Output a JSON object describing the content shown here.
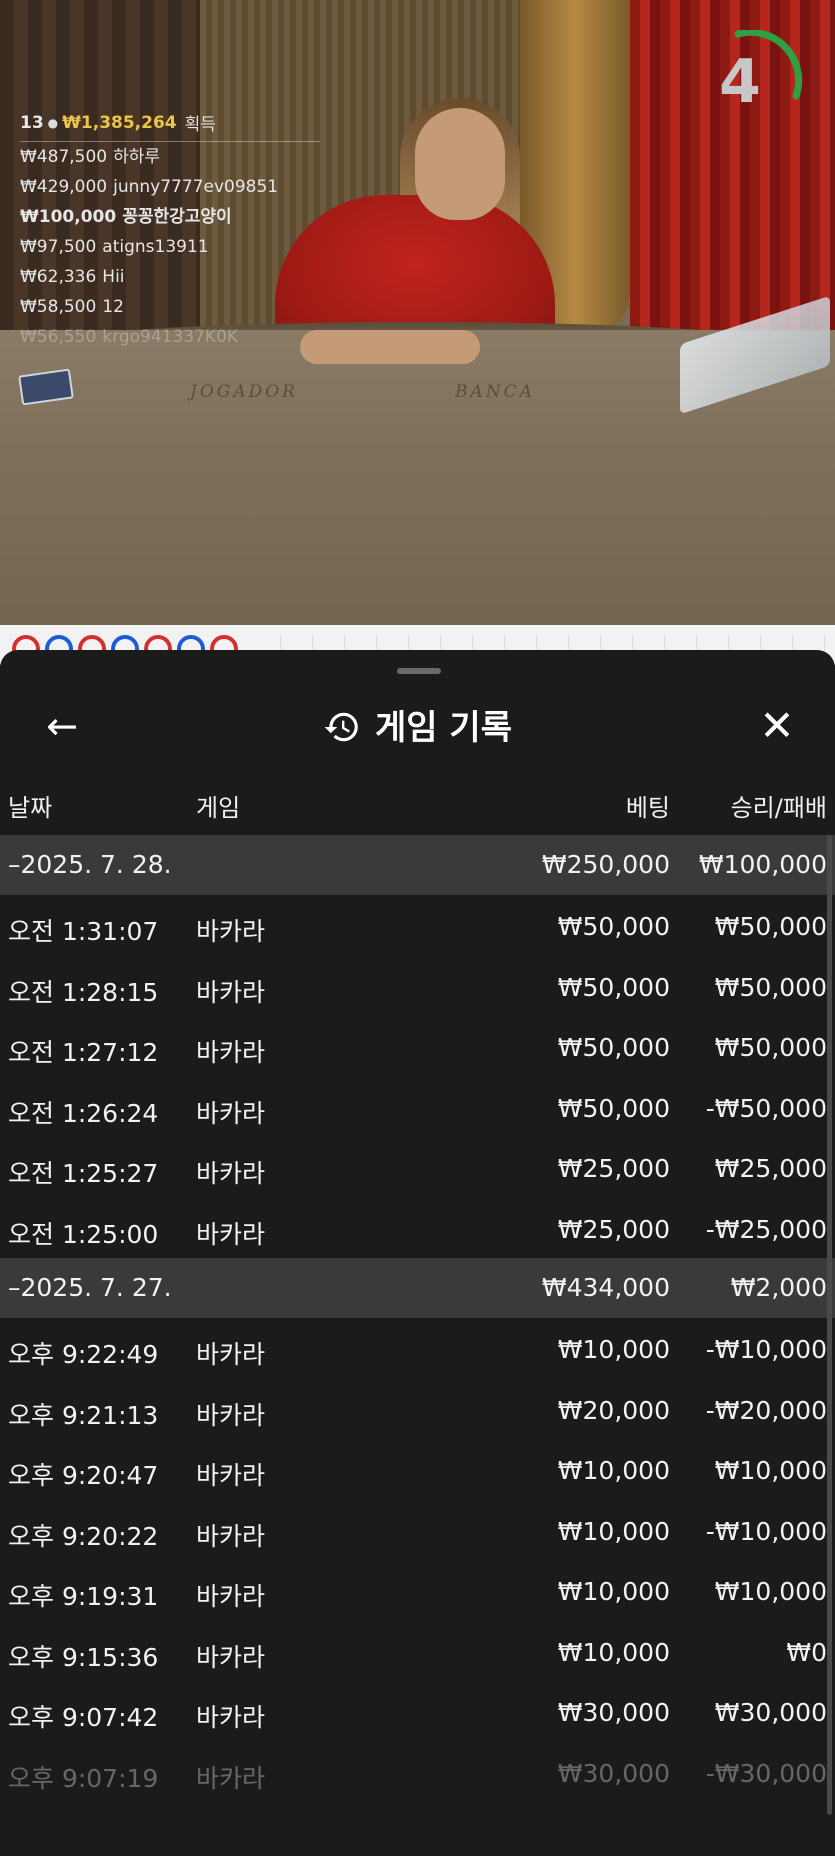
{
  "video": {
    "table_labels": [
      "JOGADOR",
      "BANCA"
    ],
    "countdown": "4",
    "winners_header": {
      "count": "13",
      "total": "₩1,385,264",
      "suffix": "획득"
    },
    "winners": [
      {
        "amount": "₩487,500",
        "name": "하하루"
      },
      {
        "amount": "₩429,000",
        "name": "junny7777ev09851"
      },
      {
        "amount": "₩100,000",
        "name": "꽁꽁한강고양이"
      },
      {
        "amount": "₩97,500",
        "name": "atigns13911"
      },
      {
        "amount": "₩62,336",
        "name": "Hii"
      },
      {
        "amount": "₩58,500",
        "name": "12"
      },
      {
        "amount": "₩56,550",
        "name": "krgo941337K0K"
      }
    ],
    "road_colors": [
      "#d32f2f",
      "#1e5bd6",
      "#d32f2f",
      "#1e5bd6",
      "#d32f2f",
      "#1e5bd6",
      "#d32f2f"
    ]
  },
  "sheet": {
    "back_icon": "arrow-left-icon",
    "title": "게임 기록",
    "title_icon": "history-icon",
    "close_icon": "close-icon",
    "columns": {
      "date": "날짜",
      "game": "게임",
      "bet": "베팅",
      "winloss": "승리/패배"
    },
    "rows": [
      {
        "type": "group",
        "date": "–2025. 7. 28.",
        "game": "",
        "bet": "₩250,000",
        "winloss": "₩100,000"
      },
      {
        "type": "item",
        "date": "오전 1:31:07",
        "game": "바카라",
        "bet": "₩50,000",
        "winloss": "₩50,000"
      },
      {
        "type": "item",
        "date": "오전 1:28:15",
        "game": "바카라",
        "bet": "₩50,000",
        "winloss": "₩50,000"
      },
      {
        "type": "item",
        "date": "오전 1:27:12",
        "game": "바카라",
        "bet": "₩50,000",
        "winloss": "₩50,000"
      },
      {
        "type": "item",
        "date": "오전 1:26:24",
        "game": "바카라",
        "bet": "₩50,000",
        "winloss": "-₩50,000"
      },
      {
        "type": "item",
        "date": "오전 1:25:27",
        "game": "바카라",
        "bet": "₩25,000",
        "winloss": "₩25,000"
      },
      {
        "type": "item",
        "date": "오전 1:25:00",
        "game": "바카라",
        "bet": "₩25,000",
        "winloss": "-₩25,000"
      },
      {
        "type": "group",
        "date": "–2025. 7. 27.",
        "game": "",
        "bet": "₩434,000",
        "winloss": "₩2,000"
      },
      {
        "type": "item",
        "date": "오후 9:22:49",
        "game": "바카라",
        "bet": "₩10,000",
        "winloss": "-₩10,000"
      },
      {
        "type": "item",
        "date": "오후 9:21:13",
        "game": "바카라",
        "bet": "₩20,000",
        "winloss": "-₩20,000"
      },
      {
        "type": "item",
        "date": "오후 9:20:47",
        "game": "바카라",
        "bet": "₩10,000",
        "winloss": "₩10,000"
      },
      {
        "type": "item",
        "date": "오후 9:20:22",
        "game": "바카라",
        "bet": "₩10,000",
        "winloss": "-₩10,000"
      },
      {
        "type": "item",
        "date": "오후 9:19:31",
        "game": "바카라",
        "bet": "₩10,000",
        "winloss": "₩10,000"
      },
      {
        "type": "item",
        "date": "오후 9:15:36",
        "game": "바카라",
        "bet": "₩10,000",
        "winloss": "₩0"
      },
      {
        "type": "item",
        "date": "오후 9:07:42",
        "game": "바카라",
        "bet": "₩30,000",
        "winloss": "₩30,000"
      },
      {
        "type": "item",
        "date": "오후 9:07:19",
        "game": "바카라",
        "bet": "₩30,000",
        "winloss": "-₩30,000"
      }
    ]
  }
}
